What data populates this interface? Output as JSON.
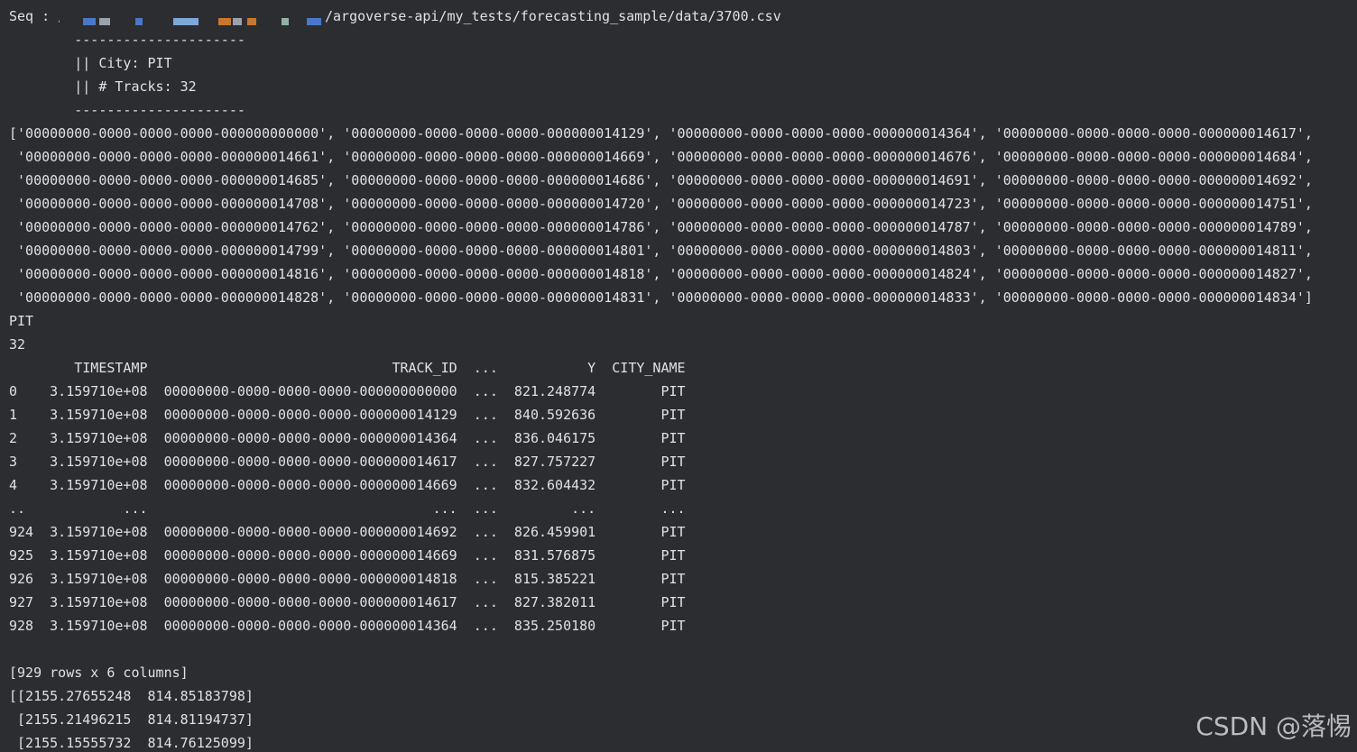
{
  "console": {
    "seq_prefix": "Seq : /",
    "seq_path_suffix": "/argoverse-api/my_tests/forecasting_sample/data/3700.csv",
    "divider_top": "        ---------------------",
    "city_line": "        || City: PIT",
    "tracks_line": "        || # Tracks: 32",
    "divider_bottom": "        ---------------------",
    "track_ids": [
      "['00000000-0000-0000-0000-000000000000', '00000000-0000-0000-0000-000000014129', '00000000-0000-0000-0000-000000014364', '00000000-0000-0000-0000-000000014617',",
      " '00000000-0000-0000-0000-000000014661', '00000000-0000-0000-0000-000000014669', '00000000-0000-0000-0000-000000014676', '00000000-0000-0000-0000-000000014684',",
      " '00000000-0000-0000-0000-000000014685', '00000000-0000-0000-0000-000000014686', '00000000-0000-0000-0000-000000014691', '00000000-0000-0000-0000-000000014692',",
      " '00000000-0000-0000-0000-000000014708', '00000000-0000-0000-0000-000000014720', '00000000-0000-0000-0000-000000014723', '00000000-0000-0000-0000-000000014751',",
      " '00000000-0000-0000-0000-000000014762', '00000000-0000-0000-0000-000000014786', '00000000-0000-0000-0000-000000014787', '00000000-0000-0000-0000-000000014789',",
      " '00000000-0000-0000-0000-000000014799', '00000000-0000-0000-0000-000000014801', '00000000-0000-0000-0000-000000014803', '00000000-0000-0000-0000-000000014811',",
      " '00000000-0000-0000-0000-000000014816', '00000000-0000-0000-0000-000000014818', '00000000-0000-0000-0000-000000014824', '00000000-0000-0000-0000-000000014827',",
      " '00000000-0000-0000-0000-000000014828', '00000000-0000-0000-0000-000000014831', '00000000-0000-0000-0000-000000014833', '00000000-0000-0000-0000-000000014834']"
    ],
    "city_value": "PIT",
    "track_count": "32",
    "dataframe": {
      "header": "        TIMESTAMP                              TRACK_ID  ...           Y  CITY_NAME",
      "rows": [
        "0    3.159710e+08  00000000-0000-0000-0000-000000000000  ...  821.248774        PIT",
        "1    3.159710e+08  00000000-0000-0000-0000-000000014129  ...  840.592636        PIT",
        "2    3.159710e+08  00000000-0000-0000-0000-000000014364  ...  836.046175        PIT",
        "3    3.159710e+08  00000000-0000-0000-0000-000000014617  ...  827.757227        PIT",
        "4    3.159710e+08  00000000-0000-0000-0000-000000014669  ...  832.604432        PIT",
        "..            ...                                   ...  ...         ...        ...",
        "924  3.159710e+08  00000000-0000-0000-0000-000000014692  ...  826.459901        PIT",
        "925  3.159710e+08  00000000-0000-0000-0000-000000014669  ...  831.576875        PIT",
        "926  3.159710e+08  00000000-0000-0000-0000-000000014818  ...  815.385221        PIT",
        "927  3.159710e+08  00000000-0000-0000-0000-000000014617  ...  827.382011        PIT",
        "928  3.159710e+08  00000000-0000-0000-0000-000000014364  ...  835.250180        PIT"
      ],
      "blank": "",
      "shape": "[929 rows x 6 columns]"
    },
    "array_lines": [
      "[[2155.27655248  814.85183798]",
      " [2155.21496215  814.81194737]",
      " [2155.15555732  814.76125099]"
    ]
  },
  "watermark": "CSDN @落惕",
  "colors": {
    "background": "#2b2d30",
    "text": "#dfe1e5",
    "redaction_blue": "#4a78c8",
    "redaction_orange": "#c9772e",
    "redaction_gray": "#9aa3ad",
    "redaction_teal": "#8fb3a5"
  }
}
